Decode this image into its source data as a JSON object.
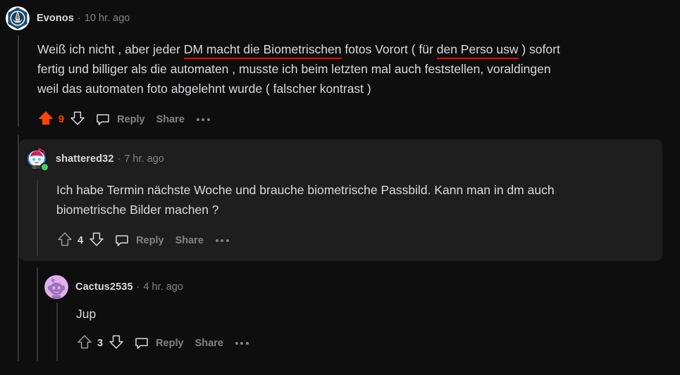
{
  "theme": {
    "background": "#0e0e0e",
    "highlight_background": "#1e1e1e",
    "text": "#d7dadc",
    "muted_text": "#818384",
    "upvote": "#ff4500",
    "thread_line": "#343536",
    "annotation": "#ff0000",
    "online": "#46d160"
  },
  "comments": [
    {
      "id": "comment-evonos",
      "author": "Evonos",
      "separator": "·",
      "timestamp": "10 hr. ago",
      "avatar_icon": "navy-compass-emblem-avatar",
      "online": false,
      "highlighted": false,
      "depth": 0,
      "lines": [
        [
          {
            "text": "Weiß ich nicht , aber jeder ",
            "underlined": false
          },
          {
            "text": "DM macht die Biometrischen",
            "underlined": true
          },
          {
            "text": " fotos Vorort ( für ",
            "underlined": false
          },
          {
            "text": "den Perso usw",
            "underlined": true
          },
          {
            "text": " ) sofort",
            "underlined": false
          }
        ],
        [
          {
            "text": "fertig und billiger als die automaten , musste ich beim letzten mal auch feststellen, voraldingen",
            "underlined": false
          }
        ],
        [
          {
            "text": "weil das automaten foto abgelehnt wurde ( falscher kontrast )",
            "underlined": false
          }
        ]
      ],
      "score": "9",
      "upvoted": true,
      "upvote_icon": "upvote-arrow-icon",
      "downvote_icon": "downvote-arrow-icon",
      "comment_icon": "comment-bubble-icon",
      "reply_label": "Reply",
      "share_label": "Share",
      "more_icon": "more-options-icon"
    },
    {
      "id": "comment-shattered32",
      "author": "shattered32",
      "separator": "·",
      "timestamp": "7 hr. ago",
      "avatar_icon": "pink-haired-snoo-avatar",
      "online": true,
      "highlighted": true,
      "depth": 1,
      "lines": [
        [
          {
            "text": "Ich habe Termin nächste Woche und brauche biometrische Passbild. Kann man in dm auch",
            "underlined": false
          }
        ],
        [
          {
            "text": "biometrische Bilder machen ?",
            "underlined": false
          }
        ]
      ],
      "score": "4",
      "upvoted": false,
      "upvote_icon": "upvote-arrow-icon",
      "downvote_icon": "downvote-arrow-icon",
      "comment_icon": "comment-bubble-icon",
      "reply_label": "Reply",
      "share_label": "Share",
      "more_icon": "more-options-icon"
    },
    {
      "id": "comment-cactus2535",
      "author": "Cactus2535",
      "separator": "·",
      "timestamp": "4 hr. ago",
      "avatar_icon": "purple-snoo-avatar",
      "online": false,
      "highlighted": false,
      "depth": 2,
      "lines": [
        [
          {
            "text": "Jup",
            "underlined": false
          }
        ]
      ],
      "score": "3",
      "upvoted": false,
      "upvote_icon": "upvote-arrow-icon",
      "downvote_icon": "downvote-arrow-icon",
      "comment_icon": "comment-bubble-icon",
      "reply_label": "Reply",
      "share_label": "Share",
      "more_icon": "more-options-icon"
    }
  ]
}
